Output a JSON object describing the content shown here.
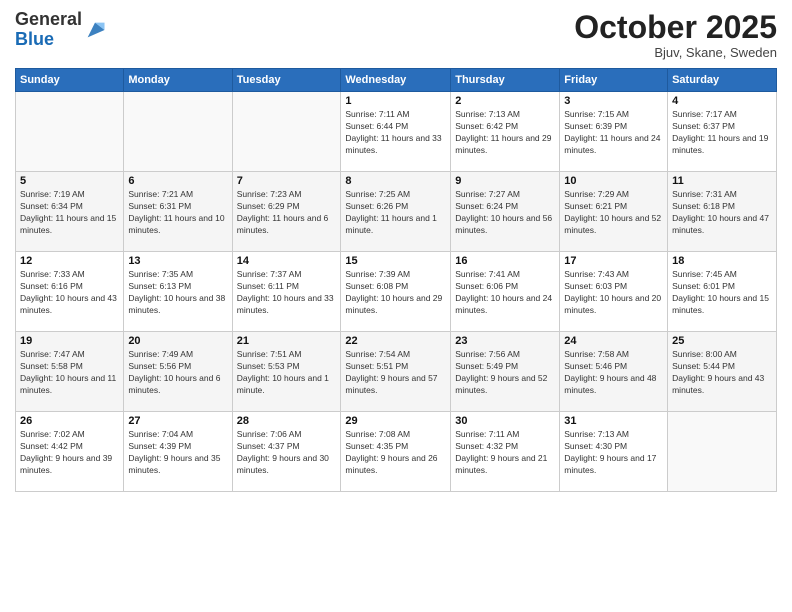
{
  "header": {
    "logo_general": "General",
    "logo_blue": "Blue",
    "month_title": "October 2025",
    "location": "Bjuv, Skane, Sweden"
  },
  "days_of_week": [
    "Sunday",
    "Monday",
    "Tuesday",
    "Wednesday",
    "Thursday",
    "Friday",
    "Saturday"
  ],
  "weeks": [
    [
      {
        "day": "",
        "info": ""
      },
      {
        "day": "",
        "info": ""
      },
      {
        "day": "",
        "info": ""
      },
      {
        "day": "1",
        "info": "Sunrise: 7:11 AM\nSunset: 6:44 PM\nDaylight: 11 hours and 33 minutes."
      },
      {
        "day": "2",
        "info": "Sunrise: 7:13 AM\nSunset: 6:42 PM\nDaylight: 11 hours and 29 minutes."
      },
      {
        "day": "3",
        "info": "Sunrise: 7:15 AM\nSunset: 6:39 PM\nDaylight: 11 hours and 24 minutes."
      },
      {
        "day": "4",
        "info": "Sunrise: 7:17 AM\nSunset: 6:37 PM\nDaylight: 11 hours and 19 minutes."
      }
    ],
    [
      {
        "day": "5",
        "info": "Sunrise: 7:19 AM\nSunset: 6:34 PM\nDaylight: 11 hours and 15 minutes."
      },
      {
        "day": "6",
        "info": "Sunrise: 7:21 AM\nSunset: 6:31 PM\nDaylight: 11 hours and 10 minutes."
      },
      {
        "day": "7",
        "info": "Sunrise: 7:23 AM\nSunset: 6:29 PM\nDaylight: 11 hours and 6 minutes."
      },
      {
        "day": "8",
        "info": "Sunrise: 7:25 AM\nSunset: 6:26 PM\nDaylight: 11 hours and 1 minute."
      },
      {
        "day": "9",
        "info": "Sunrise: 7:27 AM\nSunset: 6:24 PM\nDaylight: 10 hours and 56 minutes."
      },
      {
        "day": "10",
        "info": "Sunrise: 7:29 AM\nSunset: 6:21 PM\nDaylight: 10 hours and 52 minutes."
      },
      {
        "day": "11",
        "info": "Sunrise: 7:31 AM\nSunset: 6:18 PM\nDaylight: 10 hours and 47 minutes."
      }
    ],
    [
      {
        "day": "12",
        "info": "Sunrise: 7:33 AM\nSunset: 6:16 PM\nDaylight: 10 hours and 43 minutes."
      },
      {
        "day": "13",
        "info": "Sunrise: 7:35 AM\nSunset: 6:13 PM\nDaylight: 10 hours and 38 minutes."
      },
      {
        "day": "14",
        "info": "Sunrise: 7:37 AM\nSunset: 6:11 PM\nDaylight: 10 hours and 33 minutes."
      },
      {
        "day": "15",
        "info": "Sunrise: 7:39 AM\nSunset: 6:08 PM\nDaylight: 10 hours and 29 minutes."
      },
      {
        "day": "16",
        "info": "Sunrise: 7:41 AM\nSunset: 6:06 PM\nDaylight: 10 hours and 24 minutes."
      },
      {
        "day": "17",
        "info": "Sunrise: 7:43 AM\nSunset: 6:03 PM\nDaylight: 10 hours and 20 minutes."
      },
      {
        "day": "18",
        "info": "Sunrise: 7:45 AM\nSunset: 6:01 PM\nDaylight: 10 hours and 15 minutes."
      }
    ],
    [
      {
        "day": "19",
        "info": "Sunrise: 7:47 AM\nSunset: 5:58 PM\nDaylight: 10 hours and 11 minutes."
      },
      {
        "day": "20",
        "info": "Sunrise: 7:49 AM\nSunset: 5:56 PM\nDaylight: 10 hours and 6 minutes."
      },
      {
        "day": "21",
        "info": "Sunrise: 7:51 AM\nSunset: 5:53 PM\nDaylight: 10 hours and 1 minute."
      },
      {
        "day": "22",
        "info": "Sunrise: 7:54 AM\nSunset: 5:51 PM\nDaylight: 9 hours and 57 minutes."
      },
      {
        "day": "23",
        "info": "Sunrise: 7:56 AM\nSunset: 5:49 PM\nDaylight: 9 hours and 52 minutes."
      },
      {
        "day": "24",
        "info": "Sunrise: 7:58 AM\nSunset: 5:46 PM\nDaylight: 9 hours and 48 minutes."
      },
      {
        "day": "25",
        "info": "Sunrise: 8:00 AM\nSunset: 5:44 PM\nDaylight: 9 hours and 43 minutes."
      }
    ],
    [
      {
        "day": "26",
        "info": "Sunrise: 7:02 AM\nSunset: 4:42 PM\nDaylight: 9 hours and 39 minutes."
      },
      {
        "day": "27",
        "info": "Sunrise: 7:04 AM\nSunset: 4:39 PM\nDaylight: 9 hours and 35 minutes."
      },
      {
        "day": "28",
        "info": "Sunrise: 7:06 AM\nSunset: 4:37 PM\nDaylight: 9 hours and 30 minutes."
      },
      {
        "day": "29",
        "info": "Sunrise: 7:08 AM\nSunset: 4:35 PM\nDaylight: 9 hours and 26 minutes."
      },
      {
        "day": "30",
        "info": "Sunrise: 7:11 AM\nSunset: 4:32 PM\nDaylight: 9 hours and 21 minutes."
      },
      {
        "day": "31",
        "info": "Sunrise: 7:13 AM\nSunset: 4:30 PM\nDaylight: 9 hours and 17 minutes."
      },
      {
        "day": "",
        "info": ""
      }
    ]
  ]
}
